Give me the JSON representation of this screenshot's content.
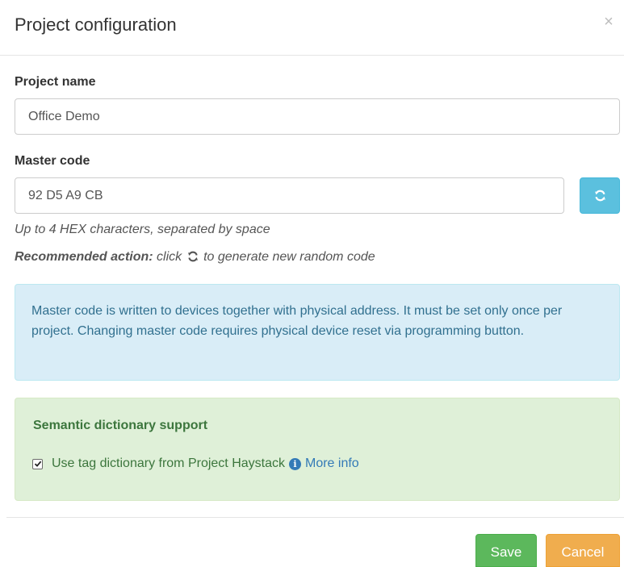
{
  "modal": {
    "title": "Project configuration",
    "close_glyph": "×"
  },
  "project_name": {
    "label": "Project name",
    "value": "Office Demo"
  },
  "master_code": {
    "label": "Master code",
    "value": "92 D5 A9 CB",
    "refresh_icon": "refresh-icon",
    "help": "Up to 4 HEX characters, separated by space",
    "recommended_bold": "Recommended action:",
    "recommended_pre": "click",
    "recommended_post": "to generate new random code"
  },
  "info_alert": {
    "text": "Master code is written to devices together with physical address. It must be set only once per project. Changing master code requires physical device reset via programming button."
  },
  "semantic": {
    "title": "Semantic dictionary support",
    "checkbox_checked": true,
    "checkbox_label": "Use tag dictionary from Project Haystack",
    "info_icon": "info-circle-icon",
    "info_glyph": "i",
    "more_info": "More info"
  },
  "footer": {
    "save_label": "Save",
    "cancel_label": "Cancel"
  },
  "colors": {
    "info_button": "#5bc0de",
    "info_alert_bg": "#d9edf7",
    "success_alert_bg": "#dff0d8",
    "save": "#5cb85c",
    "cancel": "#f0ad4e",
    "link": "#337ab7"
  }
}
